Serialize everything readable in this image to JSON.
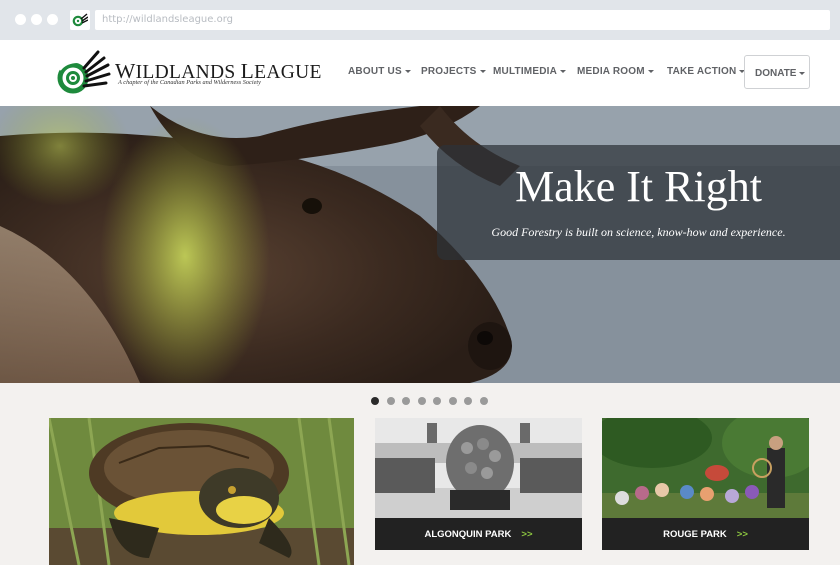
{
  "browser": {
    "url": "http://wildlandsleague.org"
  },
  "site": {
    "brand_prefix": "W",
    "brand_mid": "ILDLANDS ",
    "brand_l": "L",
    "brand_rest": "EAGUE",
    "tagline": "A chapter of the Canadian Parks and Wilderness Society",
    "colors": {
      "accent_green": "#8cc540",
      "logo_green": "#1e8a3c",
      "dark": "#222222"
    }
  },
  "nav": {
    "items": [
      {
        "label": "ABOUT US"
      },
      {
        "label": "PROJECTS"
      },
      {
        "label": "MULTIMEDIA"
      },
      {
        "label": "MEDIA ROOM"
      },
      {
        "label": "TAKE ACTION"
      }
    ],
    "donate": "DONATE"
  },
  "hero": {
    "title": "Make It Right",
    "subtitle": "Good Forestry is built on science, know-how and experience.",
    "slides_total": 8,
    "active_slide": 1
  },
  "cards": [
    {
      "image": "turtle-photo",
      "label": ""
    },
    {
      "image": "logging-truck-photo",
      "label": "ALGONQUIN PARK",
      "arrow": ">>"
    },
    {
      "image": "group-gathering-photo",
      "label": "ROUGE PARK",
      "arrow": ">>"
    }
  ]
}
